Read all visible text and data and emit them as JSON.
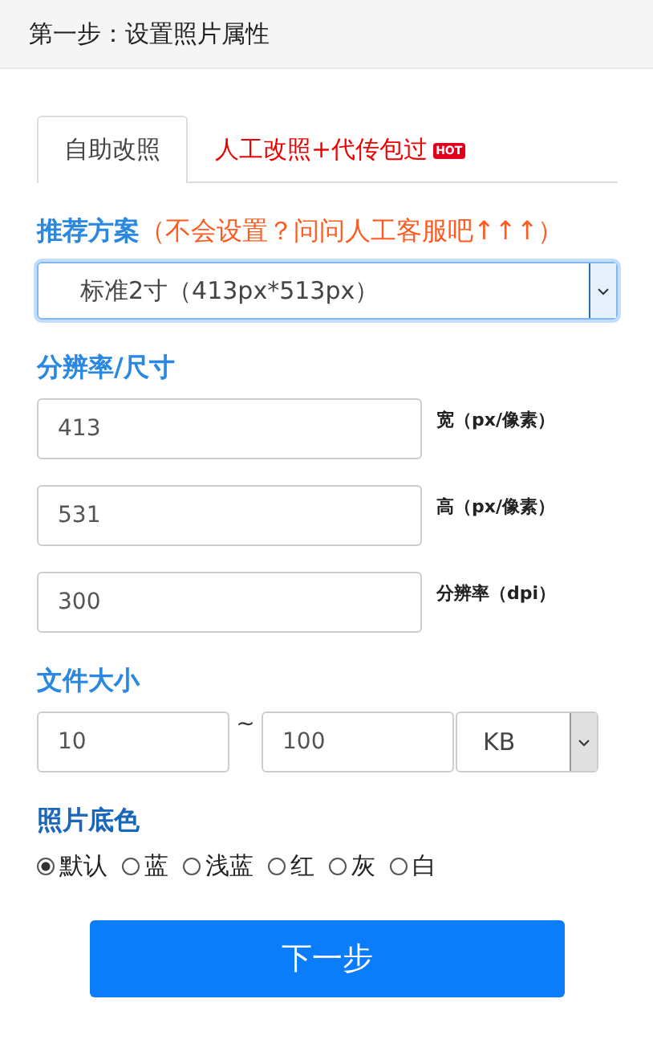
{
  "header": {
    "title": "第一步：设置照片属性"
  },
  "tabs": [
    {
      "label": "自助改照",
      "selected": true
    },
    {
      "label": "人工改照+代传包过",
      "selected": false,
      "badge": "HOT"
    }
  ],
  "plan": {
    "label": "推荐方案",
    "hint": "（不会设置？问问人工客服吧↑↑↑）",
    "value": "标准2寸（413px*513px）"
  },
  "resolution": {
    "label": "分辨率/尺寸",
    "fields": [
      {
        "value": "413",
        "unit": "宽（px/像素）"
      },
      {
        "value": "531",
        "unit": "高（px/像素）"
      },
      {
        "value": "300",
        "unit": "分辨率（dpi）"
      }
    ]
  },
  "file_size": {
    "label": "文件大小",
    "min": "10",
    "separator": "~",
    "max": "100",
    "unit": "KB"
  },
  "background": {
    "label": "照片底色",
    "options": [
      {
        "label": "默认",
        "selected": true
      },
      {
        "label": "蓝",
        "selected": false
      },
      {
        "label": "浅蓝",
        "selected": false
      },
      {
        "label": "红",
        "selected": false
      },
      {
        "label": "灰",
        "selected": false
      },
      {
        "label": "白",
        "selected": false
      }
    ]
  },
  "next_button": "下一步"
}
